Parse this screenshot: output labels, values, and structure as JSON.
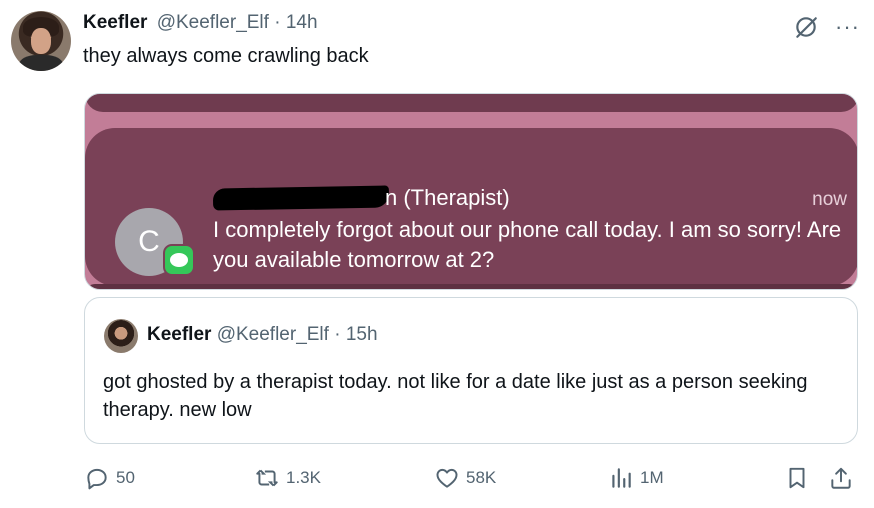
{
  "tweet": {
    "author_name": "Keefler",
    "author_handle": "@Keefler_Elf",
    "separator": "·",
    "time": "14h",
    "text": "they always come crawling back"
  },
  "media": {
    "contact_initial": "C",
    "sender_suffix": "n (Therapist)",
    "time": "now",
    "message": "I completely forgot about our phone call today. I am so sorry! Are you available tomorrow at 2?",
    "colors": {
      "background": "#c27d97",
      "card": "#7a4157",
      "messages_icon": "#35c759"
    }
  },
  "quote": {
    "author_name": "Keefler",
    "author_handle": "@Keefler_Elf",
    "separator": "·",
    "time": "15h",
    "text": "got ghosted by a therapist today. not like for a date like just as a person seeking therapy. new low"
  },
  "actions": {
    "replies": "50",
    "reposts": "1.3K",
    "likes": "58K",
    "views": "1M"
  }
}
